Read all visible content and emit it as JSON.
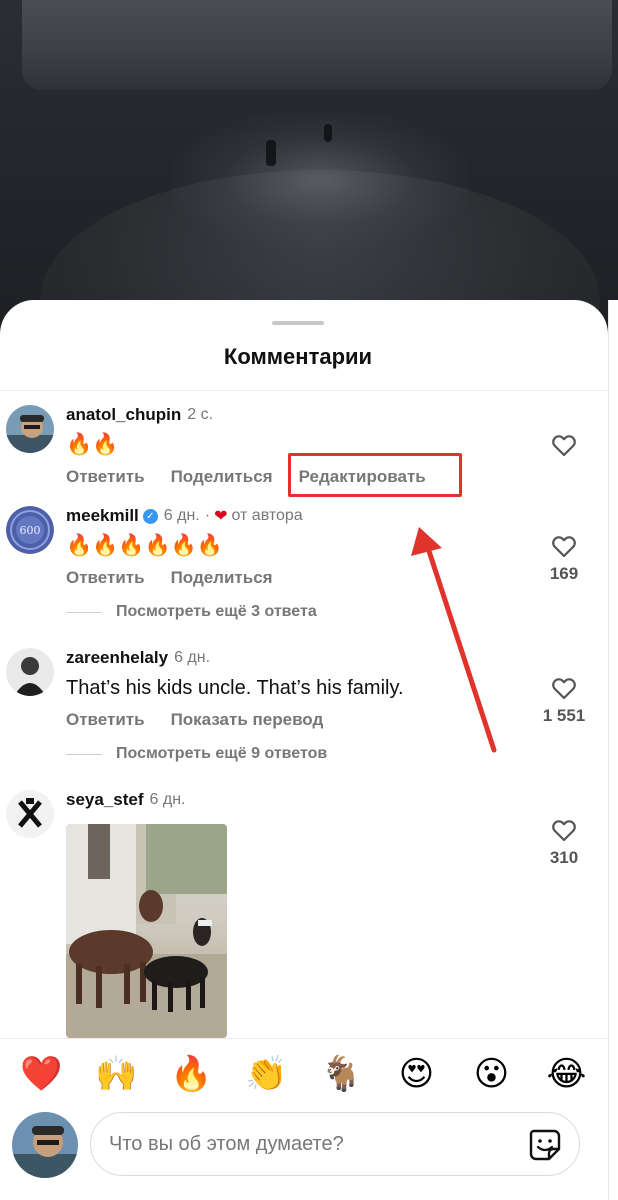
{
  "sheet": {
    "title": "Комментарии"
  },
  "comments": [
    {
      "username": "anatol_chupin",
      "time": "2 с.",
      "text": "🔥🔥",
      "actions": [
        "Ответить",
        "Поделиться",
        "Редактировать"
      ],
      "like_count": ""
    },
    {
      "username": "meekmill",
      "verified": true,
      "time": "6 дн.",
      "separator": "·",
      "author_heart": "❤",
      "author_label": "от автора",
      "text": "🔥🔥🔥🔥🔥🔥",
      "actions": [
        "Ответить",
        "Поделиться"
      ],
      "like_count": "169",
      "view_replies": "Посмотреть ещё 3 ответа"
    },
    {
      "username": "zareenhelaly",
      "time": "6 дн.",
      "text": "That’s his kids uncle. That’s his family.",
      "actions": [
        "Ответить",
        "Показать перевод"
      ],
      "like_count": "1 551",
      "view_replies": "Посмотреть ещё 9 ответов"
    },
    {
      "username": "seya_stef",
      "time": "6 дн.",
      "like_count": "310"
    }
  ],
  "emoji_bar": [
    "❤️",
    "🙌",
    "🔥",
    "👏",
    "🐐",
    "😍",
    "😮",
    "😂"
  ],
  "composer": {
    "placeholder": "Что вы об этом думаете?"
  },
  "colors": {
    "highlight": "#e0332b",
    "verified": "#3897f0",
    "author_heart": "#e0001b"
  }
}
